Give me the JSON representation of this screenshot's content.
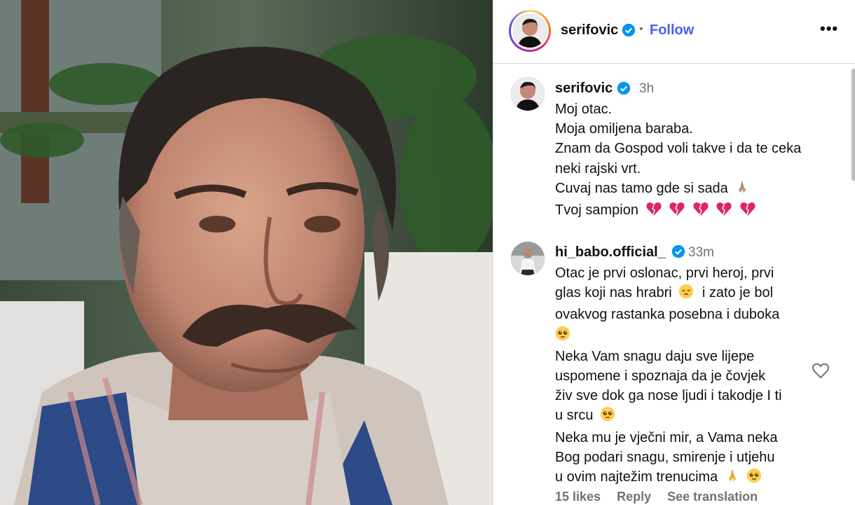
{
  "post": {
    "author": "serifovic",
    "follow_label": "Follow",
    "separator": "•",
    "more_label": "•••",
    "caption": {
      "username": "serifovic",
      "time": "3h",
      "lines": [
        "Moj otac.",
        "Moja omiljena baraba.",
        "Znam da Gospod voli takve i da te ceka",
        "neki rajski vrt.",
        "Cuvaj nas tamo gde si sada",
        "Tvoj sampion"
      ],
      "emoji_line5": "praying-hands-emoji",
      "emoji_line6": [
        "broken-heart",
        "broken-heart",
        "broken-heart",
        "broken-heart",
        "broken-heart"
      ]
    },
    "comment": {
      "username": "hi_babo.official_",
      "time": "33m",
      "lines": [
        "Otac je prvi oslonac, prvi heroj, prvi",
        "glas koji nas hrabri",
        "i zato je bol",
        "ovakvog rastanka posebna i duboka",
        "Neka Vam snagu daju sve lijepe",
        "uspomene i spoznaja da je čovjek",
        "živ sve dok ga nose ljudi i takodje I ti",
        "u srcu",
        "Neka mu je vječni mir, a Vama neka",
        "Bog podari snagu, smirenje i utjehu",
        "u ovim najtežim trenucima"
      ],
      "likes": "15 likes",
      "reply_label": "Reply",
      "translate_label": "See translation"
    },
    "colors": {
      "link": "#4a5df9",
      "verified": "#0095f6",
      "muted": "#737373",
      "broken_heart": "#e0245e"
    }
  }
}
